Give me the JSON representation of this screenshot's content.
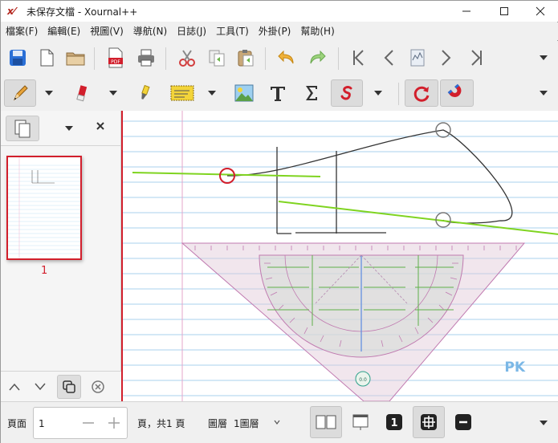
{
  "window": {
    "title": "未保存文檔 - Xournal++",
    "app_icon_glyph": "x⁄"
  },
  "menu": [
    "檔案(F)",
    "編輯(E)",
    "視圖(V)",
    "導航(N)",
    "日誌(J)",
    "工具(T)",
    "外掛(P)",
    "幫助(H)"
  ],
  "toolbar1": {
    "icons": [
      "save-icon",
      "new-document-icon",
      "open-folder-icon",
      "export-pdf-icon",
      "print-icon",
      "cut-icon",
      "copy-icon",
      "paste-icon",
      "undo-icon",
      "redo-icon",
      "first-page-icon",
      "previous-page-icon",
      "goto-page-icon",
      "next-page-icon",
      "last-page-icon"
    ],
    "pdf_label": "PDF"
  },
  "toolbar2": {
    "icons": [
      "pen-icon",
      "eraser-icon",
      "highlighter-icon",
      "text-selection-icon",
      "image-icon",
      "text-tool-icon",
      "math-sigma-icon",
      "hand-icon",
      "rotation-snap-icon",
      "grid-snap-magnet-icon"
    ]
  },
  "sidebar": {
    "page_number": "1"
  },
  "canvas": {
    "watermark": "PK",
    "geometry_set_label": "0.0"
  },
  "statusbar": {
    "page_label": "頁面",
    "page_value": "1",
    "page_total": "頁，共1 頁",
    "layer_label": "圖層",
    "layer_value": "1圖層",
    "page_number_badge": "1"
  },
  "colors": {
    "accent_red": "#d21f2c",
    "ruled_line_blue": "#a9d1ee",
    "margin_pink": "#e6a5c8",
    "green_stroke": "#7fd420"
  }
}
